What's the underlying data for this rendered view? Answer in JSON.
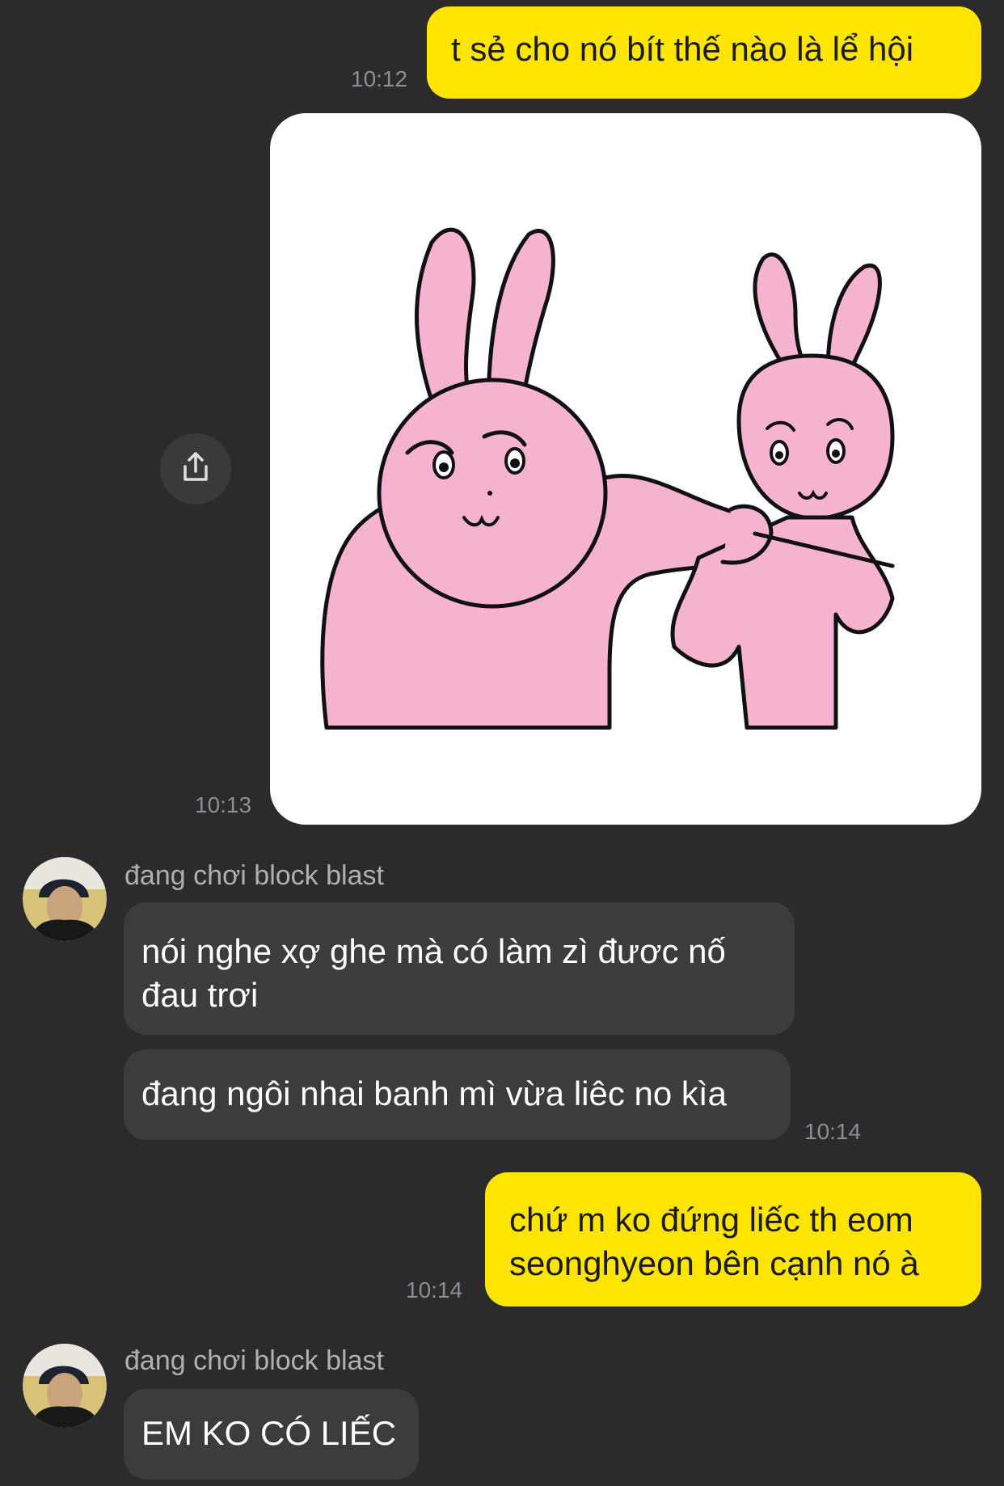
{
  "messages": {
    "m1": {
      "text": "t sẻ cho nó bít thế nào là lể hội",
      "time": "10:12"
    },
    "sticker": {
      "time": "10:13",
      "icon": "share-icon"
    },
    "group1": {
      "sender": "đang chơi block blast",
      "bubble1": "nói nghe xợ ghe mà có làm zì đươc nố đau trơi",
      "bubble2": "đang ngôi nhai banh mì vừa liêc no kìa",
      "time": "10:14"
    },
    "m2": {
      "text": "chứ m ko đứng liếc th eom seonghyeon bên cạnh nó à",
      "time": "10:14"
    },
    "group2": {
      "sender": "đang chơi block blast",
      "bubble1": "EM KO CÓ LIẾC"
    }
  },
  "colors": {
    "background": "#2b2b2d",
    "outgoing_bubble": "#fee500",
    "incoming_bubble": "#3c3c3f",
    "rabbit_pink": "#f6b3cf"
  }
}
